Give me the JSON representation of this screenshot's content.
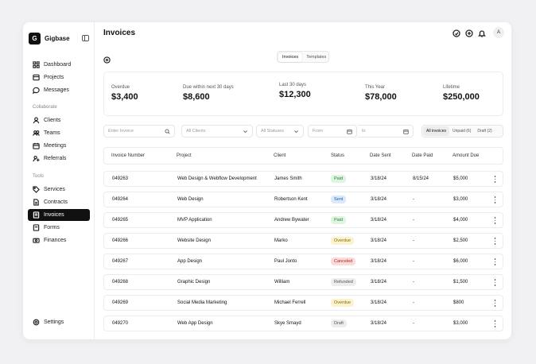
{
  "app": {
    "name": "Gigbase",
    "logo_letter": "G"
  },
  "sidebar": {
    "items": [
      {
        "label": "Dashboard",
        "icon": "dashboard-icon"
      },
      {
        "label": "Projects",
        "icon": "projects-icon"
      },
      {
        "label": "Messages",
        "icon": "messages-icon"
      }
    ],
    "collaborate_label": "Collaborate",
    "collaborate": [
      {
        "label": "Clients",
        "icon": "user-icon"
      },
      {
        "label": "Teams",
        "icon": "users-icon"
      },
      {
        "label": "Meetings",
        "icon": "calendar-icon"
      },
      {
        "label": "Referrals",
        "icon": "referral-icon"
      }
    ],
    "tools_label": "Tools",
    "tools": [
      {
        "label": "Services",
        "icon": "tag-icon"
      },
      {
        "label": "Contracts",
        "icon": "contract-icon"
      },
      {
        "label": "Invoices",
        "icon": "invoice-icon",
        "active": true
      },
      {
        "label": "Forms",
        "icon": "form-icon"
      },
      {
        "label": "Finances",
        "icon": "finance-icon"
      }
    ],
    "settings": "Settings"
  },
  "header": {
    "title": "Invoices",
    "avatar": "A"
  },
  "view_tabs": [
    "Invoices",
    "Templates"
  ],
  "stats": [
    {
      "label": "Overdue",
      "value": "$3,400"
    },
    {
      "label": "Due within next 30 days",
      "value": "$8,600"
    },
    {
      "label": "Last 30 days",
      "value": "$12,300"
    },
    {
      "label": "This Year",
      "value": "$78,000"
    },
    {
      "label": "Lifetime",
      "value": "$250,000"
    }
  ],
  "filters": {
    "search_placeholder": "Enter Invoice",
    "clients": "All Clients",
    "statuses": "All Statuses",
    "from": "From",
    "to": "to"
  },
  "status_tabs": [
    "All invoices",
    "Unpaid (6)",
    "Draft (2)"
  ],
  "table": {
    "headers": [
      "Invoice Number",
      "Project",
      "Client",
      "Status",
      "Date Sent",
      "Date Paid",
      "Amount Due"
    ],
    "rows": [
      {
        "num": "049263",
        "project": "Web Design & Webflow Development",
        "client": "James Smith",
        "status": "Paid",
        "sent": "3/18/24",
        "paid": "8/15/24",
        "amount": "$5,000"
      },
      {
        "num": "049264",
        "project": "Web Design",
        "client": "Robertson Kent",
        "status": "Sent",
        "sent": "3/18/24",
        "paid": "-",
        "amount": "$3,000"
      },
      {
        "num": "049265",
        "project": "MVP Application",
        "client": "Andrew Bywater",
        "status": "Paid",
        "sent": "3/18/24",
        "paid": "-",
        "amount": "$4,000"
      },
      {
        "num": "049266",
        "project": "Website Design",
        "client": "Marko",
        "status": "Overdue",
        "sent": "3/18/24",
        "paid": "-",
        "amount": "$2,500"
      },
      {
        "num": "049267",
        "project": "App Design",
        "client": "Paul Jonto",
        "status": "Canceled",
        "sent": "3/18/24",
        "paid": "-",
        "amount": "$6,000"
      },
      {
        "num": "049268",
        "project": "Graphic Design",
        "client": "William",
        "status": "Refunded",
        "sent": "3/18/24",
        "paid": "-",
        "amount": "$1,500"
      },
      {
        "num": "049269",
        "project": "Social Media Marketing",
        "client": "Michael Ferrell",
        "status": "Overdue",
        "sent": "3/18/24",
        "paid": "-",
        "amount": "$800"
      },
      {
        "num": "049270",
        "project": "Web App Design",
        "client": "Skye Smayd",
        "status": "Draft",
        "sent": "3/18/24",
        "paid": "-",
        "amount": "$3,000"
      }
    ]
  },
  "status_colors": {
    "Paid": {
      "bg": "#dff5e1",
      "fg": "#2e7d32"
    },
    "Sent": {
      "bg": "#dbe9fb",
      "fg": "#1f5fa8"
    },
    "Overdue": {
      "bg": "#fbf3d0",
      "fg": "#8a6d00"
    },
    "Canceled": {
      "bg": "#fbdcdc",
      "fg": "#b42318"
    },
    "Refunded": {
      "bg": "#ededed",
      "fg": "#555555"
    },
    "Draft": {
      "bg": "#ededed",
      "fg": "#555555"
    }
  }
}
